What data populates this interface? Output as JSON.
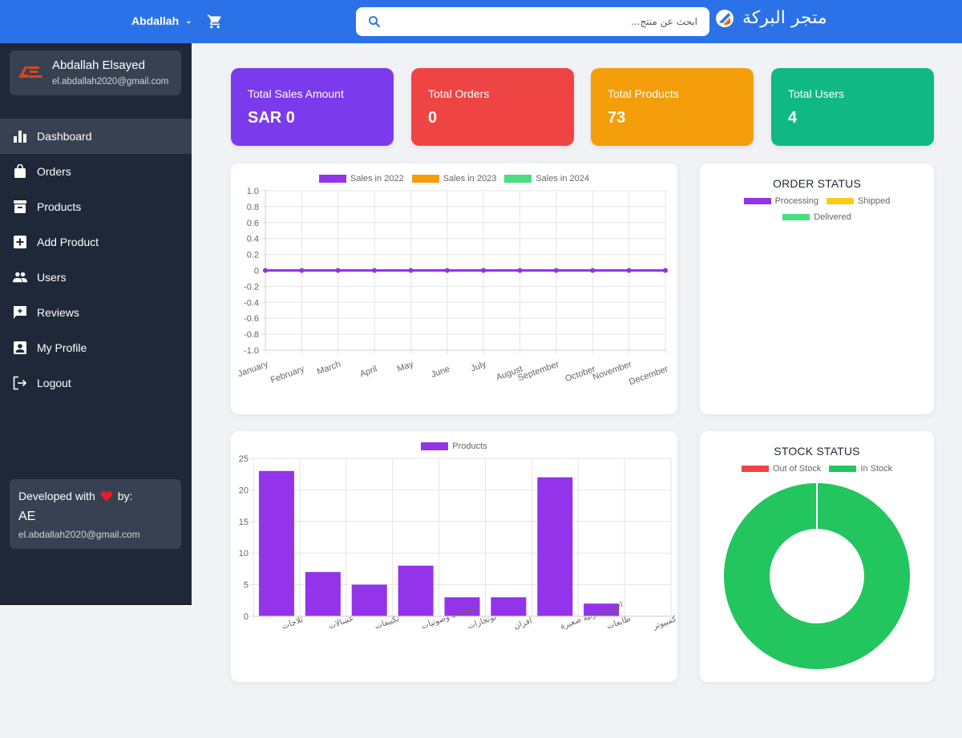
{
  "topbar": {
    "user_name": "Abdallah",
    "brand_name": "متجر البركة",
    "search": {
      "placeholder": "ابحث عن منتج...",
      "value": ""
    },
    "icons": {
      "cart": "cart-icon",
      "search": "search-icon",
      "chevron": "chevron-down-icon",
      "logo": "brand-logo-icon"
    },
    "color": "#2b72e8"
  },
  "sidebar": {
    "profile": {
      "name": "Abdallah Elsayed",
      "email": "el.abdallah2020@gmail.com",
      "logo_text": "AE"
    },
    "items": [
      {
        "label": "Dashboard",
        "icon": "bar-chart-icon",
        "active": true
      },
      {
        "label": "Orders",
        "icon": "shopping-bag-icon"
      },
      {
        "label": "Products",
        "icon": "archive-box-icon"
      },
      {
        "label": "Add Product",
        "icon": "plus-square-icon"
      },
      {
        "label": "Users",
        "icon": "users-icon"
      },
      {
        "label": "Reviews",
        "icon": "review-comment-icon"
      },
      {
        "label": "My Profile",
        "icon": "profile-card-icon"
      },
      {
        "label": "Logout",
        "icon": "logout-icon"
      }
    ],
    "developer": {
      "prefix": "Developed with",
      "suffix": "by:",
      "name": "AE",
      "email": "el.abdallah2020@gmail.com"
    }
  },
  "stats": [
    {
      "label": "Total Sales Amount",
      "value": "SAR 0",
      "color": "#7c3aed"
    },
    {
      "label": "Total Orders",
      "value": "0",
      "color": "#ef4444"
    },
    {
      "label": "Total Products",
      "value": "73",
      "color": "#f59e0b"
    },
    {
      "label": "Total Users",
      "value": "4",
      "color": "#10b981"
    }
  ],
  "chart_data": [
    {
      "type": "line",
      "title": "",
      "categories": [
        "January",
        "February",
        "March",
        "April",
        "May",
        "June",
        "July",
        "August",
        "September",
        "October",
        "November",
        "December"
      ],
      "series": [
        {
          "name": "Sales in 2022",
          "color": "#9333ea",
          "values": [
            0,
            0,
            0,
            0,
            0,
            0,
            0,
            0,
            0,
            0,
            0,
            0
          ]
        },
        {
          "name": "Sales in 2023",
          "color": "#f59e0b",
          "values": [
            0,
            0,
            0,
            0,
            0,
            0,
            0,
            0,
            0,
            0,
            0,
            0
          ]
        },
        {
          "name": "Sales in 2024",
          "color": "#4ade80",
          "values": [
            0,
            0,
            0,
            0,
            0,
            0,
            0,
            0,
            0,
            0,
            0,
            0
          ]
        }
      ],
      "ylim": [
        -1.0,
        1.0
      ],
      "yticks": [
        "1.0",
        "0.8",
        "0.6",
        "0.4",
        "0.2",
        "0",
        "-0.2",
        "-0.4",
        "-0.6",
        "-0.8",
        "-1.0"
      ],
      "grid": true,
      "legend": "top"
    },
    {
      "type": "pie",
      "title": "ORDER STATUS",
      "categories": [
        "Processing",
        "Shipped",
        "Delivered"
      ],
      "colors": [
        "#9333ea",
        "#facc15",
        "#4ade80"
      ],
      "values": [
        0,
        0,
        0
      ],
      "legend": "top"
    },
    {
      "type": "bar",
      "title": "",
      "categories": [
        "ثلاجات",
        "غسالات",
        "تكييفات",
        "شاشات وصوتيات",
        "بوتجازات",
        "افران",
        "اجهزة منزلية صغيرة",
        "طابعات",
        "كمبيوتر"
      ],
      "series": [
        {
          "name": "Products",
          "color": "#9333ea",
          "values": [
            23,
            7,
            5,
            8,
            3,
            3,
            22,
            2,
            0
          ]
        }
      ],
      "ylim": [
        0,
        25
      ],
      "yticks": [
        "25",
        "20",
        "15",
        "10",
        "5",
        "0"
      ],
      "grid": true,
      "legend": "top"
    },
    {
      "type": "pie",
      "title": "STOCK STATUS",
      "categories": [
        "Out of Stock",
        "In Stock"
      ],
      "colors": [
        "#ef4444",
        "#22c55e"
      ],
      "values": [
        0,
        73
      ],
      "legend": "top"
    }
  ]
}
